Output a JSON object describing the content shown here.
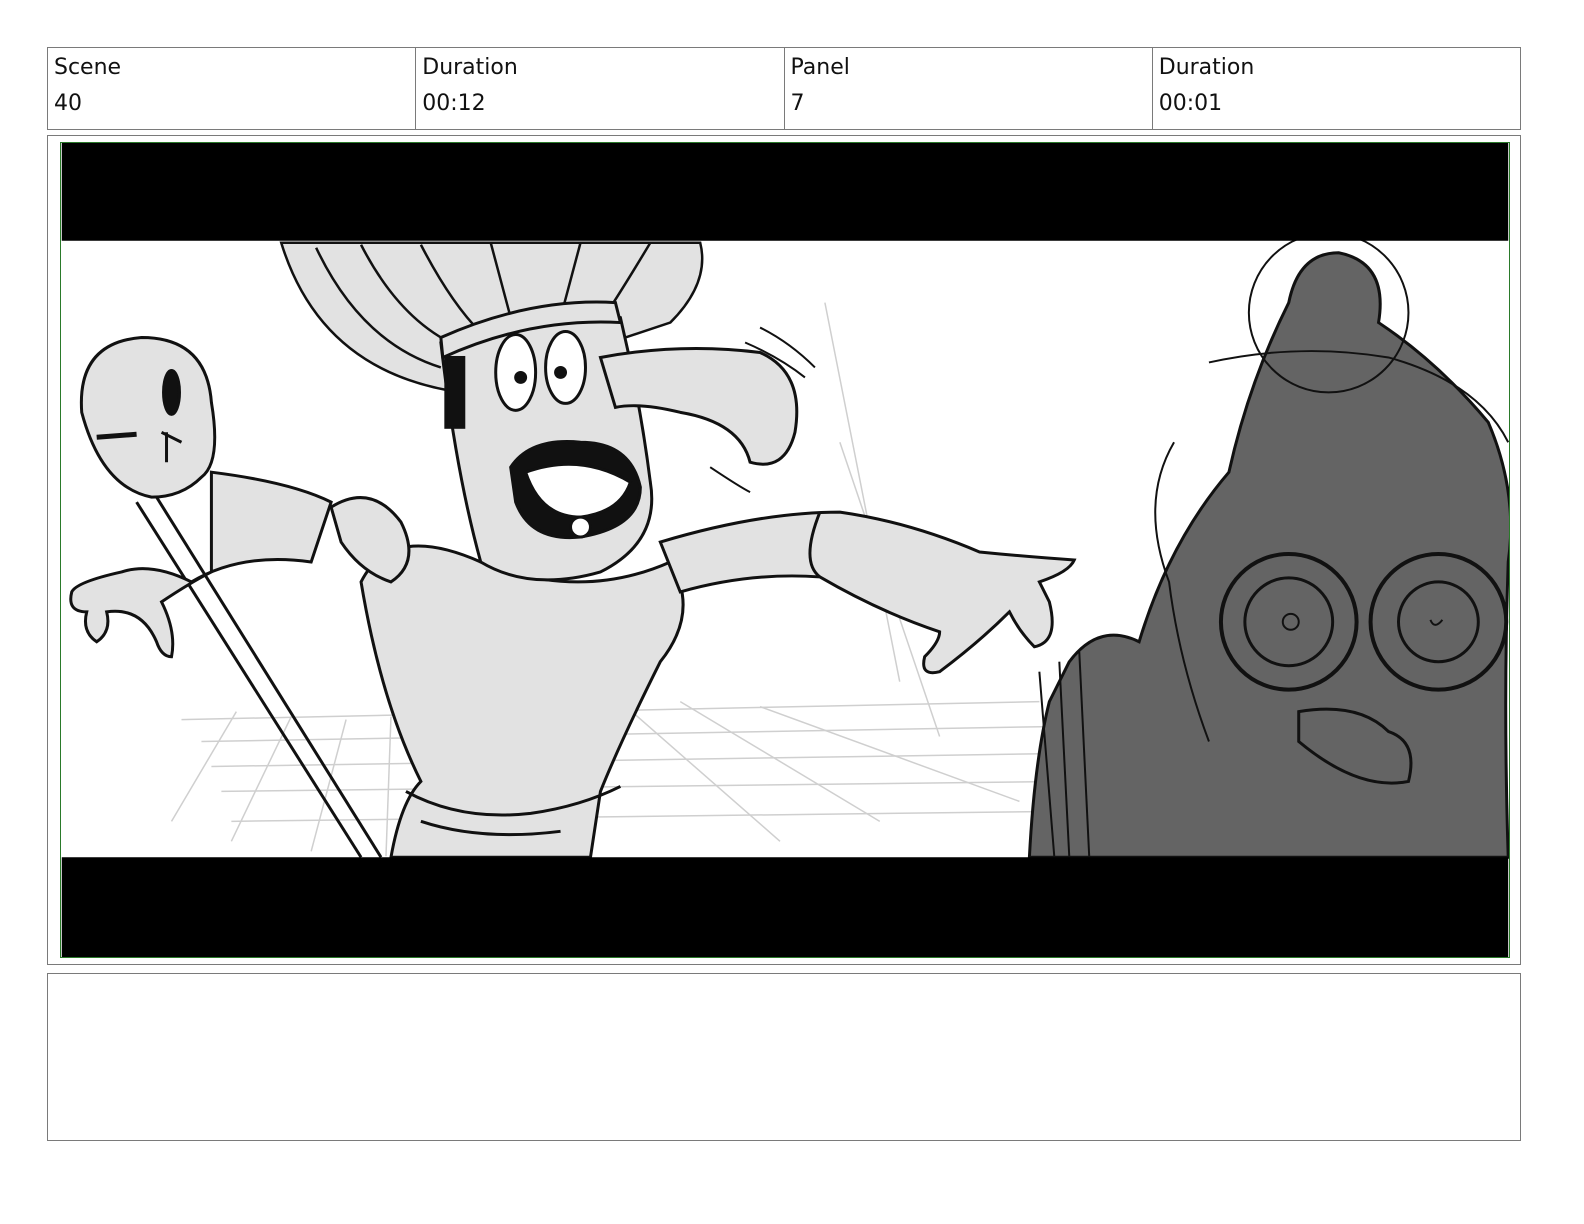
{
  "header": {
    "scene_label": "Scene",
    "scene_value": "40",
    "scene_duration_label": "Duration",
    "scene_duration_value": "00:12",
    "panel_label": "Panel",
    "panel_value": "7",
    "panel_duration_label": "Duration",
    "panel_duration_value": "00:01"
  },
  "notes": {
    "text": ""
  },
  "colors": {
    "frame_border": "#2a7a2a",
    "letterbox": "#000000",
    "character_fill": "#e2e2e2",
    "foreground_fill": "#646464"
  }
}
